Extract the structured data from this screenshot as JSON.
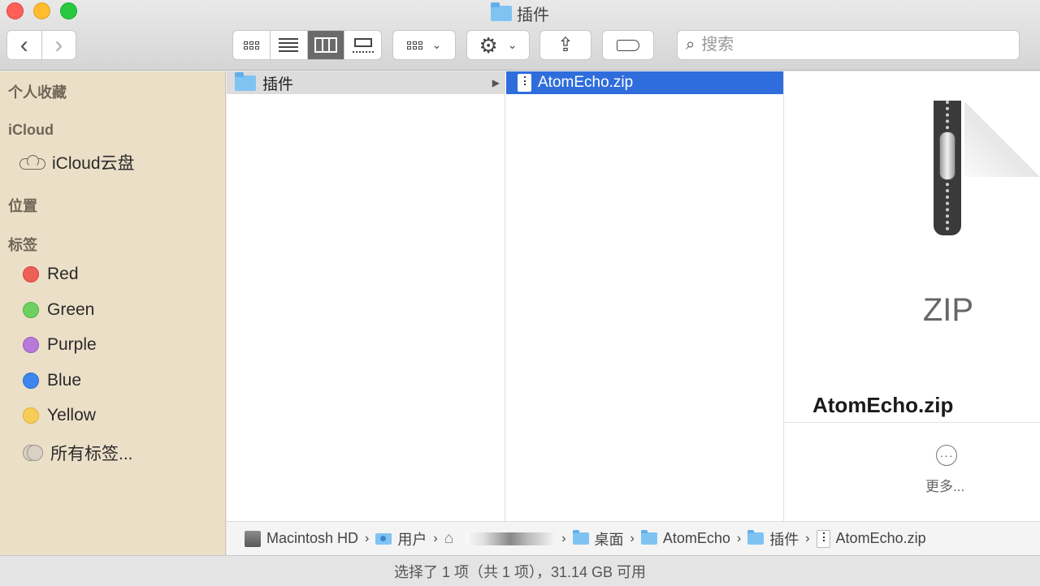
{
  "window": {
    "title": "插件"
  },
  "toolbar": {
    "back_glyph": "‹",
    "forward_glyph": "›",
    "share_glyph": "⇪",
    "search": {
      "placeholder": "搜索",
      "value": ""
    }
  },
  "sidebar": {
    "sections": {
      "favorites": "个人收藏",
      "icloud": "iCloud",
      "locations": "位置",
      "tags": "标签"
    },
    "icloud_drive": "iCloud云盘",
    "tags": [
      {
        "label": "Red",
        "color": "#ee5f56"
      },
      {
        "label": "Green",
        "color": "#6fcf61"
      },
      {
        "label": "Purple",
        "color": "#b77ad9"
      },
      {
        "label": "Blue",
        "color": "#3d86f0"
      },
      {
        "label": "Yellow",
        "color": "#f8cd57"
      }
    ],
    "all_tags": "所有标签..."
  },
  "columns": {
    "col1": [
      {
        "label": "插件",
        "icon": "folder-icon"
      }
    ],
    "col2": [
      {
        "label": "AtomEcho.zip",
        "icon": "zip-file-icon",
        "selected": true
      }
    ]
  },
  "preview": {
    "type_label": "ZIP",
    "file_name": "AtomEcho.zip",
    "more_glyph": "···",
    "more_label": "更多..."
  },
  "pathbar": {
    "items": [
      "Macintosh HD",
      "用户",
      "桌面",
      "AtomEcho",
      "插件",
      "AtomEcho.zip"
    ]
  },
  "status": {
    "text": "选择了 1 项（共 1 项），31.14 GB 可用"
  }
}
